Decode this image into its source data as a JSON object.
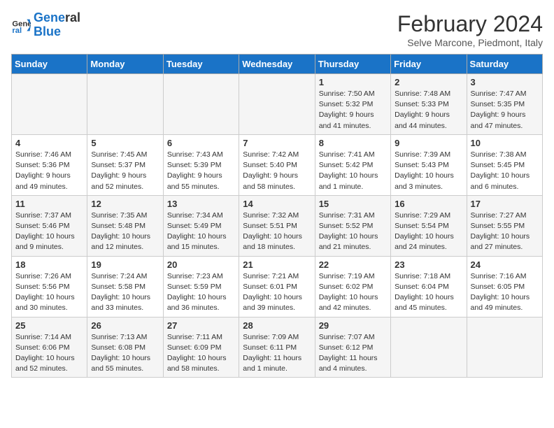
{
  "header": {
    "logo_line1": "General",
    "logo_line2": "Blue",
    "month_title": "February 2024",
    "location": "Selve Marcone, Piedmont, Italy"
  },
  "weekdays": [
    "Sunday",
    "Monday",
    "Tuesday",
    "Wednesday",
    "Thursday",
    "Friday",
    "Saturday"
  ],
  "weeks": [
    [
      {
        "day": "",
        "info": ""
      },
      {
        "day": "",
        "info": ""
      },
      {
        "day": "",
        "info": ""
      },
      {
        "day": "",
        "info": ""
      },
      {
        "day": "1",
        "info": "Sunrise: 7:50 AM\nSunset: 5:32 PM\nDaylight: 9 hours\nand 41 minutes."
      },
      {
        "day": "2",
        "info": "Sunrise: 7:48 AM\nSunset: 5:33 PM\nDaylight: 9 hours\nand 44 minutes."
      },
      {
        "day": "3",
        "info": "Sunrise: 7:47 AM\nSunset: 5:35 PM\nDaylight: 9 hours\nand 47 minutes."
      }
    ],
    [
      {
        "day": "4",
        "info": "Sunrise: 7:46 AM\nSunset: 5:36 PM\nDaylight: 9 hours\nand 49 minutes."
      },
      {
        "day": "5",
        "info": "Sunrise: 7:45 AM\nSunset: 5:37 PM\nDaylight: 9 hours\nand 52 minutes."
      },
      {
        "day": "6",
        "info": "Sunrise: 7:43 AM\nSunset: 5:39 PM\nDaylight: 9 hours\nand 55 minutes."
      },
      {
        "day": "7",
        "info": "Sunrise: 7:42 AM\nSunset: 5:40 PM\nDaylight: 9 hours\nand 58 minutes."
      },
      {
        "day": "8",
        "info": "Sunrise: 7:41 AM\nSunset: 5:42 PM\nDaylight: 10 hours\nand 1 minute."
      },
      {
        "day": "9",
        "info": "Sunrise: 7:39 AM\nSunset: 5:43 PM\nDaylight: 10 hours\nand 3 minutes."
      },
      {
        "day": "10",
        "info": "Sunrise: 7:38 AM\nSunset: 5:45 PM\nDaylight: 10 hours\nand 6 minutes."
      }
    ],
    [
      {
        "day": "11",
        "info": "Sunrise: 7:37 AM\nSunset: 5:46 PM\nDaylight: 10 hours\nand 9 minutes."
      },
      {
        "day": "12",
        "info": "Sunrise: 7:35 AM\nSunset: 5:48 PM\nDaylight: 10 hours\nand 12 minutes."
      },
      {
        "day": "13",
        "info": "Sunrise: 7:34 AM\nSunset: 5:49 PM\nDaylight: 10 hours\nand 15 minutes."
      },
      {
        "day": "14",
        "info": "Sunrise: 7:32 AM\nSunset: 5:51 PM\nDaylight: 10 hours\nand 18 minutes."
      },
      {
        "day": "15",
        "info": "Sunrise: 7:31 AM\nSunset: 5:52 PM\nDaylight: 10 hours\nand 21 minutes."
      },
      {
        "day": "16",
        "info": "Sunrise: 7:29 AM\nSunset: 5:54 PM\nDaylight: 10 hours\nand 24 minutes."
      },
      {
        "day": "17",
        "info": "Sunrise: 7:27 AM\nSunset: 5:55 PM\nDaylight: 10 hours\nand 27 minutes."
      }
    ],
    [
      {
        "day": "18",
        "info": "Sunrise: 7:26 AM\nSunset: 5:56 PM\nDaylight: 10 hours\nand 30 minutes."
      },
      {
        "day": "19",
        "info": "Sunrise: 7:24 AM\nSunset: 5:58 PM\nDaylight: 10 hours\nand 33 minutes."
      },
      {
        "day": "20",
        "info": "Sunrise: 7:23 AM\nSunset: 5:59 PM\nDaylight: 10 hours\nand 36 minutes."
      },
      {
        "day": "21",
        "info": "Sunrise: 7:21 AM\nSunset: 6:01 PM\nDaylight: 10 hours\nand 39 minutes."
      },
      {
        "day": "22",
        "info": "Sunrise: 7:19 AM\nSunset: 6:02 PM\nDaylight: 10 hours\nand 42 minutes."
      },
      {
        "day": "23",
        "info": "Sunrise: 7:18 AM\nSunset: 6:04 PM\nDaylight: 10 hours\nand 45 minutes."
      },
      {
        "day": "24",
        "info": "Sunrise: 7:16 AM\nSunset: 6:05 PM\nDaylight: 10 hours\nand 49 minutes."
      }
    ],
    [
      {
        "day": "25",
        "info": "Sunrise: 7:14 AM\nSunset: 6:06 PM\nDaylight: 10 hours\nand 52 minutes."
      },
      {
        "day": "26",
        "info": "Sunrise: 7:13 AM\nSunset: 6:08 PM\nDaylight: 10 hours\nand 55 minutes."
      },
      {
        "day": "27",
        "info": "Sunrise: 7:11 AM\nSunset: 6:09 PM\nDaylight: 10 hours\nand 58 minutes."
      },
      {
        "day": "28",
        "info": "Sunrise: 7:09 AM\nSunset: 6:11 PM\nDaylight: 11 hours\nand 1 minute."
      },
      {
        "day": "29",
        "info": "Sunrise: 7:07 AM\nSunset: 6:12 PM\nDaylight: 11 hours\nand 4 minutes."
      },
      {
        "day": "",
        "info": ""
      },
      {
        "day": "",
        "info": ""
      }
    ]
  ]
}
